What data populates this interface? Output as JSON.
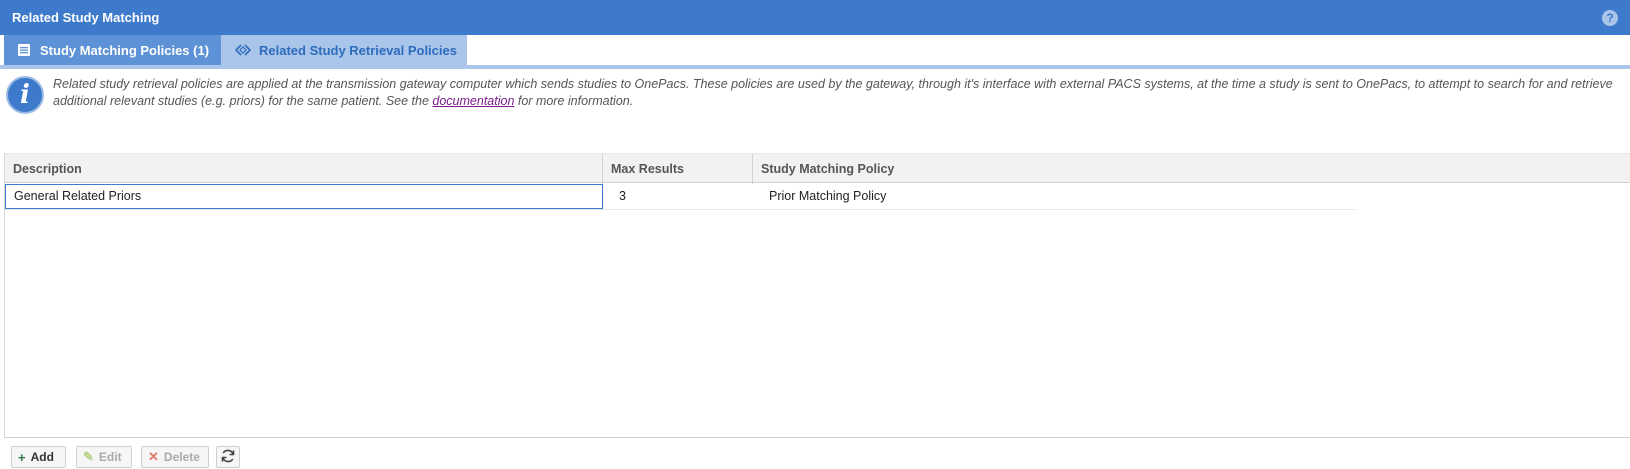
{
  "window": {
    "title": "Related Study Matching",
    "help_icon": "help-icon",
    "help_glyph": "?"
  },
  "tabs": [
    {
      "label": "Study Matching Policies (1)",
      "icon": "list-icon",
      "active": false
    },
    {
      "label": "Related Study Retrieval Policies",
      "icon": "diamond-arrows-icon",
      "active": true
    }
  ],
  "info": {
    "icon_glyph": "i",
    "text_before": "Related study retrieval policies are applied at the transmission gateway computer which sends studies to OnePacs. These policies are used by the gateway, through it's interface with external PACS systems, at the time a study is sent to OnePacs, to attempt to search for and retrieve additional relevant studies (e.g. priors) for the same patient. See the ",
    "link_text": "documentation",
    "text_after": " for more information."
  },
  "grid": {
    "columns": [
      "Description",
      "Max Results",
      "Study Matching Policy"
    ],
    "rows": [
      {
        "description": "General Related Priors",
        "max_results": "3",
        "policy": "Prior Matching Policy"
      }
    ]
  },
  "toolbar": {
    "add_label": "Add",
    "edit_label": "Edit",
    "delete_label": "Delete",
    "refresh_icon": "refresh-icon"
  },
  "colors": {
    "title_bar": "#3d7acb",
    "tab_inactive": "#5d93d6",
    "tab_active": "#a9c5ea",
    "link": "#7a1c8a"
  }
}
